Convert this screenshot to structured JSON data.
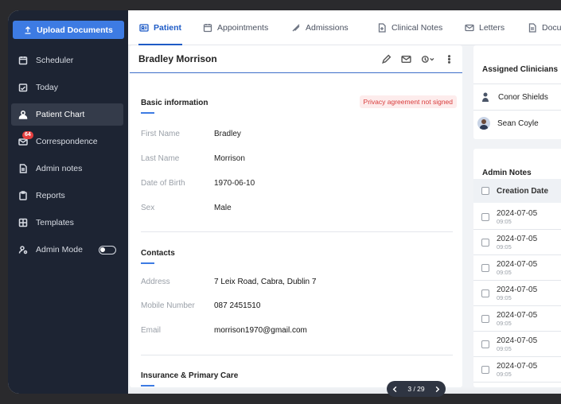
{
  "sidebar": {
    "upload_label": "Upload Documents",
    "items": [
      {
        "label": "Scheduler",
        "icon": "calendar-icon"
      },
      {
        "label": "Today",
        "icon": "today-icon"
      },
      {
        "label": "Patient Chart",
        "icon": "person-icon"
      },
      {
        "label": "Correspondence",
        "icon": "mail-icon",
        "badge": "64"
      },
      {
        "label": "Admin notes",
        "icon": "document-icon"
      },
      {
        "label": "Reports",
        "icon": "clipboard-icon"
      },
      {
        "label": "Templates",
        "icon": "grid-icon"
      },
      {
        "label": "Admin Mode",
        "icon": "admin-icon"
      }
    ]
  },
  "tabs": [
    {
      "label": "Patient",
      "active": true
    },
    {
      "label": "Appointments"
    },
    {
      "label": "Admissions"
    },
    {
      "label": "Clinical Notes"
    },
    {
      "label": "Letters"
    },
    {
      "label": "Docume"
    }
  ],
  "patient": {
    "name": "Bradley Morrison",
    "basic_title": "Basic information",
    "privacy_badge": "Privacy agreement not signed",
    "first_name_label": "First Name",
    "first_name": "Bradley",
    "last_name_label": "Last Name",
    "last_name": "Morrison",
    "dob_label": "Date of Birth",
    "dob": "1970-06-10",
    "sex_label": "Sex",
    "sex": "Male",
    "contacts_title": "Contacts",
    "address_label": "Address",
    "address": "7 Leix Road, Cabra, Dublin 7",
    "mobile_label": "Mobile Number",
    "mobile": "087 2451510",
    "email_label": "Email",
    "email": "morrison1970@gmail.com",
    "insurance_title": "Insurance & Primary Care"
  },
  "clinicians": {
    "title": "Assigned Clinicians",
    "list": [
      "Conor Shields",
      "Sean Coyle"
    ]
  },
  "admin_notes": {
    "title": "Admin Notes",
    "column": "Creation Date",
    "rows": [
      {
        "date": "2024-07-05",
        "time": "09:05"
      },
      {
        "date": "2024-07-05",
        "time": "09:05"
      },
      {
        "date": "2024-07-05",
        "time": "09:05"
      },
      {
        "date": "2024-07-05",
        "time": "09:05"
      },
      {
        "date": "2024-07-05",
        "time": "09:05"
      },
      {
        "date": "2024-07-05",
        "time": "09:05"
      },
      {
        "date": "2024-07-05",
        "time": "09:05"
      }
    ]
  },
  "pager": {
    "text": "3 / 29"
  },
  "colors": {
    "accent": "#3d7be3",
    "sidebar": "#1d2433",
    "danger": "#d83b3b"
  }
}
